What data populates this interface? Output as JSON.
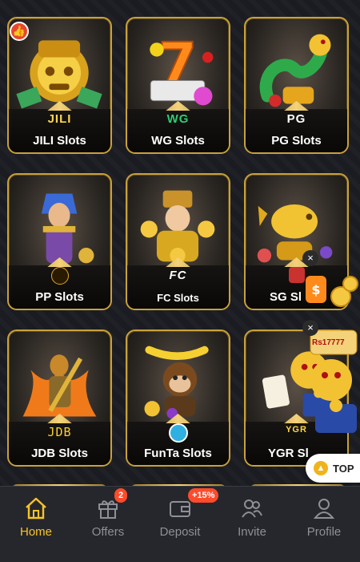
{
  "games": [
    {
      "brand": "JILI",
      "title": "JILI Slots",
      "art": "golden-lion-mask"
    },
    {
      "brand": "WG",
      "title": "WG Slots",
      "art": "lucky-seven-slot"
    },
    {
      "brand": "PG",
      "title": "PG Slots",
      "art": "golden-dragon"
    },
    {
      "brand": "",
      "title": "PP Slots",
      "art": "egyptian-queen"
    },
    {
      "brand": "FC",
      "title": "FC Slots",
      "art": "fortune-god"
    },
    {
      "brand": "",
      "title": "SG Sl",
      "art": "golden-koi-fish"
    },
    {
      "brand": "JDB",
      "title": "JDB Slots",
      "art": "monkey-king"
    },
    {
      "brand": "",
      "title": "FunTa Slots",
      "art": "monkey-with-banana"
    },
    {
      "brand": "YGR",
      "title": "YGR Sl",
      "art": "lion-dance-treasure"
    }
  ],
  "promo": {
    "banner_text": "Rs17777",
    "close_label": "×"
  },
  "top_button": {
    "label": "TOP"
  },
  "nav": {
    "items": [
      {
        "label": "Home",
        "icon": "home-icon",
        "active": true
      },
      {
        "label": "Offers",
        "icon": "gift-icon",
        "badge": "2"
      },
      {
        "label": "Deposit",
        "icon": "wallet-icon",
        "badge": "+15%"
      },
      {
        "label": "Invite",
        "icon": "people-icon"
      },
      {
        "label": "Profile",
        "icon": "person-icon"
      }
    ]
  },
  "colors": {
    "accent": "#f7c428",
    "badge": "#ff4b2b",
    "frame": "#c9a13a"
  }
}
